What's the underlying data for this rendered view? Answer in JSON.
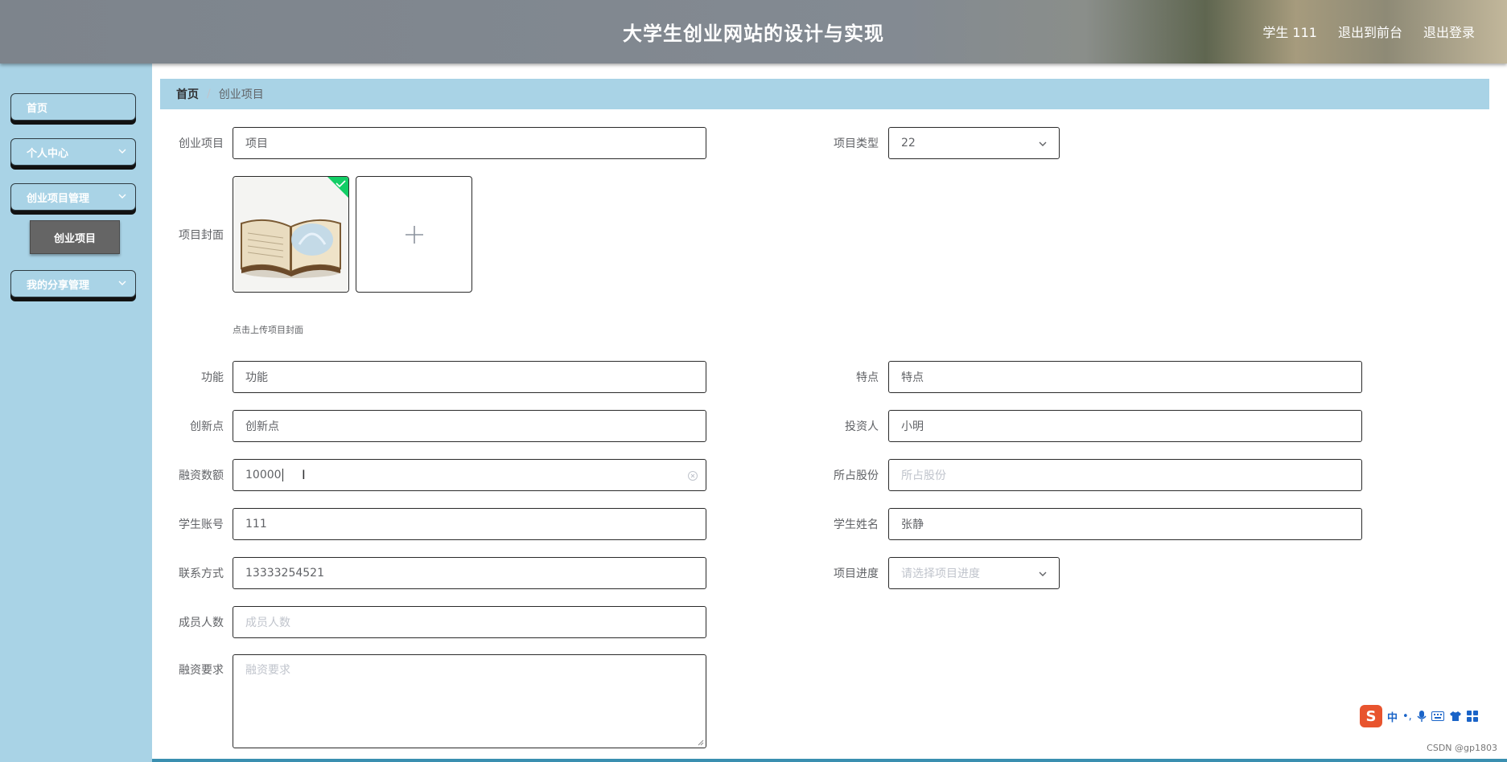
{
  "header": {
    "title": "大学生创业网站的设计与实现",
    "user": "学生 111",
    "back_to_front": "退出到前台",
    "logout": "退出登录"
  },
  "sidebar": {
    "items": [
      {
        "label": "首页"
      },
      {
        "label": "个人中心"
      },
      {
        "label": "创业项目管理"
      },
      {
        "label": "我的分享管理"
      }
    ],
    "sub_item": "创业项目"
  },
  "breadcrumb": {
    "home": "首页",
    "separator": "/",
    "current": "创业项目"
  },
  "form": {
    "project_name": {
      "label": "创业项目",
      "value": "项目"
    },
    "project_type": {
      "label": "项目类型",
      "value": "22"
    },
    "cover": {
      "label": "项目封面",
      "hint": "点击上传项目封面"
    },
    "function": {
      "label": "功能",
      "value": "功能"
    },
    "feature": {
      "label": "特点",
      "value": "特点"
    },
    "innovation": {
      "label": "创新点",
      "value": "创新点"
    },
    "investor": {
      "label": "投资人",
      "value": "小明"
    },
    "financing_amount": {
      "label": "融资数额",
      "value": "10000"
    },
    "equity_share": {
      "label": "所占股份",
      "placeholder": "所占股份"
    },
    "student_account": {
      "label": "学生账号",
      "value": "111"
    },
    "student_name": {
      "label": "学生姓名",
      "value": "张静"
    },
    "contact": {
      "label": "联系方式",
      "value": "13333254521"
    },
    "progress": {
      "label": "项目进度",
      "placeholder": "请选择项目进度"
    },
    "members": {
      "label": "成员人数",
      "placeholder": "成员人数"
    },
    "financing_requirement": {
      "label": "融资要求",
      "placeholder": "融资要求"
    }
  },
  "ime_bar": {
    "mode": "中",
    "punct": "•,"
  },
  "watermark": "CSDN @gp1803",
  "colors": {
    "sidebar_bg": "#a9d3e6",
    "active_sub_bg": "#656565",
    "upload_success": "#13ce66"
  }
}
